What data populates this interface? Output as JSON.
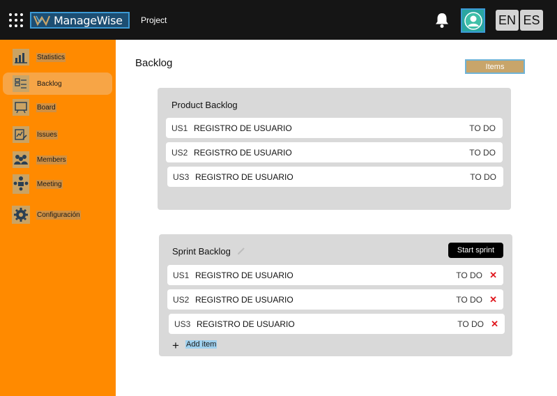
{
  "header": {
    "logo_text": "ManageWise",
    "project_link": "Project",
    "languages": [
      "EN",
      "ES"
    ]
  },
  "sidebar": {
    "items": [
      {
        "label": "Statistics",
        "icon": "chart-icon"
      },
      {
        "label": "Backlog",
        "icon": "backlog-icon",
        "active": true
      },
      {
        "label": "Board",
        "icon": "board-icon"
      },
      {
        "label": "Issues",
        "icon": "issues-icon"
      },
      {
        "label": "Members",
        "icon": "members-icon"
      },
      {
        "label": "Meeting",
        "icon": "meeting-icon"
      },
      {
        "label": "Configuración",
        "icon": "gear-icon"
      }
    ]
  },
  "main": {
    "title": "Backlog",
    "items_button": "Items",
    "product_backlog": {
      "title": "Product Backlog",
      "rows": [
        {
          "id": "US1",
          "name": "REGISTRO DE USUARIO",
          "status": "TO DO"
        },
        {
          "id": "US2",
          "name": "REGISTRO DE USUARIO",
          "status": "TO DO"
        },
        {
          "id": "US3",
          "name": "REGISTRO DE USUARIO",
          "status": "TO DO"
        }
      ]
    },
    "sprint_backlog": {
      "title": "Sprint Backlog",
      "start_button": "Start sprint",
      "remove_symbol": "✕",
      "add_item": "Add item",
      "rows": [
        {
          "id": "US1",
          "name": "REGISTRO DE USUARIO",
          "status": "TO DO"
        },
        {
          "id": "US2",
          "name": "REGISTRO DE USUARIO",
          "status": "TO DO"
        },
        {
          "id": "US3",
          "name": "REGISTRO DE USUARIO",
          "status": "TO DO"
        }
      ]
    }
  },
  "colors": {
    "topbar": "#151515",
    "sidebar": "#ff8a00",
    "sidebar_active": "#f7a546",
    "panel": "#d9d9d9",
    "remove": "#e0161d",
    "accent": "#c8a56a"
  }
}
